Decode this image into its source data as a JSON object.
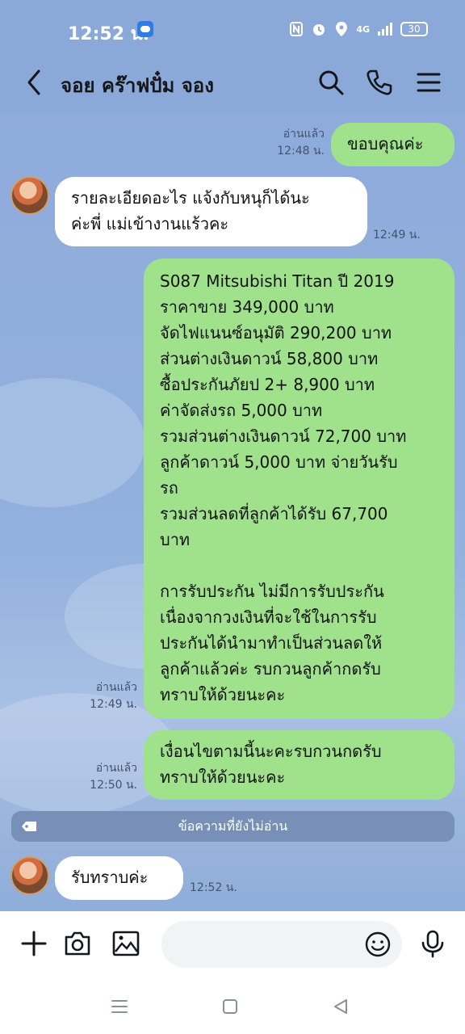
{
  "status": {
    "time": "12:52 น.",
    "battery": "30",
    "network": "4G"
  },
  "header": {
    "title": "จอย คร๊าฟปั๋ม จอง"
  },
  "messages": [
    {
      "id": "m1",
      "text": "ขอบคุณค่ะ",
      "read": "อ่านแล้ว",
      "time": "12:48 น."
    },
    {
      "id": "m2",
      "text": "รายละเอียดอะไร แจ้งกับหนุก็ได้นะ\nค่ะพี่ แม่เข้างานแร้วคะ",
      "time": "12:49 น."
    },
    {
      "id": "m3",
      "text": "S087 Mitsubishi Titan ปี 2019\nราคาขาย 349,000 บาท\nจัดไฟแนนซ์อนุมัติ 290,200 บาท\nส่วนต่างเงินดาวน์ 58,800 บาท\nซื้อประกันภัยป 2+ 8,900 บาท\nค่าจัดส่งรถ 5,000 บาท\nรวมส่วนต่างเงินดาวน์ 72,700 บาท\nลูกค้าดาวน์ 5,000 บาท จ่ายวันรับ\nรถ\nรวมส่วนลดที่ลูกค้าได้รับ 67,700\nบาท\n\nการรับประกัน ไม่มีการรับประกัน\nเนื่องจากวงเงินที่จะใช้ในการรับ\nประกันได้นำมาทำเป็นส่วนลดให้\nลูกค้าแล้วค่ะ รบกวนลูกค้ากดรับ\nทราบให้ด้วยนะคะ",
      "read": "อ่านแล้ว",
      "time": "12:49 น."
    },
    {
      "id": "m4",
      "text": "เงื่อนไขตามนี้นะคะรบกวนกดรับ\nทราบให้ด้วยนะคะ",
      "read": "อ่านแล้ว",
      "time": "12:50 น."
    },
    {
      "id": "m5",
      "text": "รับทราบค่ะ",
      "time": "12:52 น."
    }
  ],
  "unread_label": "ข้อความที่ยังไม่อ่าน",
  "icons": [
    "back-icon",
    "search-icon",
    "phone-icon",
    "menu-icon",
    "plus-icon",
    "camera-icon",
    "image-icon",
    "emoji-icon",
    "mic-icon",
    "recents-icon",
    "home-icon",
    "back-nav-icon"
  ],
  "colors": {
    "header": "#8aa9d9",
    "out_bubble": "#a0e28b",
    "in_bubble": "#ffffff",
    "unread_bar": "#7890b8"
  }
}
